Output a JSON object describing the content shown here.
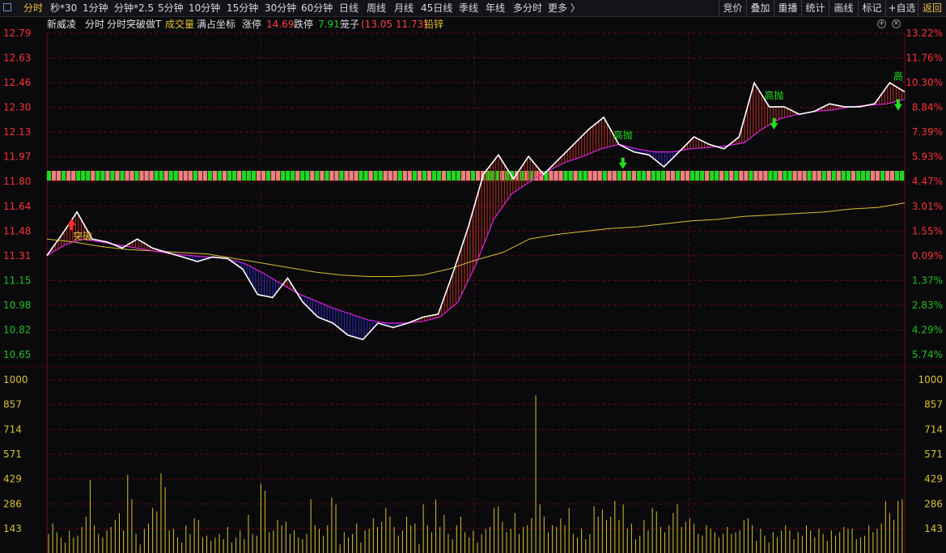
{
  "toolbar": {
    "periods": [
      {
        "label": "分时",
        "active": true
      },
      {
        "label": "秒*30"
      },
      {
        "label": "1分钟"
      },
      {
        "label": "分钟*2.5"
      },
      {
        "label": "5分钟"
      },
      {
        "label": "10分钟"
      },
      {
        "label": "15分钟"
      },
      {
        "label": "30分钟"
      },
      {
        "label": "60分钟"
      },
      {
        "label": "日线"
      },
      {
        "label": "周线"
      },
      {
        "label": "月线"
      },
      {
        "label": "45日线"
      },
      {
        "label": "季线"
      },
      {
        "label": "年线"
      },
      {
        "label": "多分时"
      },
      {
        "label": "更多 〉"
      }
    ],
    "right_buttons": [
      "竞价",
      "叠加",
      "重播",
      "统计",
      "画线",
      "标记",
      "+自选",
      "返回"
    ],
    "back_color": "#f0c040"
  },
  "info": {
    "stock_name": "新威凌",
    "chart_type": "分时",
    "indicator": "分时突破做T",
    "volume_label": "成交量",
    "coord_mode": "满占坐标",
    "limit_up_label": "涨停",
    "limit_up_value": "14.69",
    "limit_down_label": "跌停",
    "limit_down_value": "7.91",
    "cage_label": "笼子",
    "cage_value": "(13.05 11.73)",
    "sector": "铅锌"
  },
  "chart_data": {
    "type": "line",
    "price_axis": {
      "ticks": [
        "12.79",
        "12.63",
        "12.46",
        "12.30",
        "12.13",
        "11.97",
        "11.80",
        "11.64",
        "11.48",
        "11.31",
        "11.15",
        "10.98",
        "10.82",
        "10.65"
      ],
      "ylim": [
        10.65,
        12.79
      ]
    },
    "percent_axis": {
      "ticks": [
        "13.22%",
        "11.76%",
        "10.30%",
        "8.84%",
        "7.39%",
        "5.93%",
        "4.47%",
        "3.01%",
        "1.55%",
        "0.09%",
        "1.37%",
        "2.83%",
        "4.29%",
        "5.74%"
      ]
    },
    "volume_axis": {
      "ticks": [
        "1000",
        "857",
        "714",
        "571",
        "429",
        "286",
        "143"
      ],
      "ylim": [
        0,
        1000
      ]
    },
    "x": [
      0,
      15,
      30,
      45,
      60,
      75,
      90,
      105,
      120,
      135,
      150,
      165,
      180,
      195,
      210,
      225,
      240,
      255,
      270,
      285,
      300,
      315,
      330,
      345,
      360,
      375,
      390,
      405,
      420,
      435,
      450,
      465,
      480,
      495,
      510,
      525,
      540,
      555,
      570,
      585,
      600,
      615,
      630,
      645,
      660,
      675,
      690,
      705,
      720,
      735,
      750,
      765,
      780,
      795,
      810,
      825,
      840,
      855,
      870,
      885,
      900,
      915,
      930,
      945,
      960,
      975,
      990,
      1005,
      1020,
      1035,
      1050
    ],
    "series": [
      {
        "values": [
          11.31,
          11.45,
          11.6,
          11.42,
          11.4,
          11.36,
          11.42,
          11.36,
          11.33,
          11.3,
          11.27,
          11.3,
          11.29,
          11.22,
          11.05,
          11.03,
          11.16,
          11.0,
          10.9,
          10.86,
          10.78,
          10.75,
          10.86,
          10.83,
          10.86,
          10.9,
          10.92,
          11.2,
          11.5,
          11.85,
          11.98,
          11.82,
          11.97,
          11.85,
          11.95,
          12.05,
          12.15,
          12.23,
          12.05,
          12.0,
          11.98,
          11.9,
          12.0,
          12.1,
          12.05,
          12.02,
          12.1,
          12.46,
          12.3,
          12.3,
          12.25,
          12.27,
          12.32,
          12.3,
          12.3,
          12.32,
          12.46,
          12.4
        ]
      },
      {
        "values": [
          11.31,
          11.38,
          11.42,
          11.4,
          11.38,
          11.36,
          11.34,
          11.32,
          11.31,
          11.3,
          11.29,
          11.26,
          11.2,
          11.13,
          11.06,
          11.01,
          10.96,
          10.92,
          10.88,
          10.86,
          10.86,
          10.87,
          10.9,
          11.0,
          11.25,
          11.55,
          11.72,
          11.8,
          11.87,
          11.93,
          11.97,
          12.02,
          12.05,
          12.02,
          12.0,
          12.0,
          12.02,
          12.03,
          12.04,
          12.06,
          12.15,
          12.22,
          12.25,
          12.27,
          12.28,
          12.3,
          12.31,
          12.32,
          12.35
        ]
      },
      {
        "values": [
          11.42,
          11.4,
          11.37,
          11.35,
          11.34,
          11.33,
          11.32,
          11.29,
          11.26,
          11.23,
          11.2,
          11.18,
          11.17,
          11.17,
          11.18,
          11.22,
          11.28,
          11.33,
          11.42,
          11.45,
          11.47,
          11.49,
          11.5,
          11.52,
          11.54,
          11.55,
          11.57,
          11.58,
          11.59,
          11.6,
          11.62,
          11.63,
          11.66
        ]
      }
    ],
    "volume": [
      110,
      170,
      120,
      90,
      60,
      130,
      90,
      100,
      150,
      210,
      420,
      160,
      110,
      90,
      130,
      150,
      190,
      230,
      130,
      450,
      310,
      110,
      50,
      140,
      170,
      260,
      240,
      460,
      380,
      130,
      140,
      90,
      60,
      160,
      110,
      200,
      190,
      90,
      100,
      70,
      90,
      110,
      80,
      150,
      60,
      90,
      130,
      80,
      220,
      110,
      100,
      400,
      360,
      120,
      130,
      190,
      160,
      180,
      110,
      130,
      90,
      80,
      110,
      310,
      160,
      140,
      100,
      160,
      320,
      280,
      50,
      120,
      90,
      110,
      170,
      60,
      130,
      140,
      200,
      150,
      180,
      260,
      210,
      150,
      100,
      130,
      210,
      160,
      170,
      50,
      280,
      160,
      120,
      310,
      150,
      220,
      110,
      80,
      160,
      210,
      120,
      90,
      130,
      60,
      110,
      140,
      150,
      260,
      270,
      180,
      120,
      140,
      230,
      110,
      150,
      160,
      200,
      910,
      280,
      210,
      120,
      160,
      150,
      200,
      160,
      260,
      110,
      90,
      140,
      80,
      110,
      270,
      210,
      250,
      190,
      210,
      300,
      190,
      280,
      140,
      170,
      80,
      100,
      190,
      130,
      260,
      240,
      150,
      120,
      160,
      230,
      280,
      150,
      180,
      200,
      170,
      110,
      100,
      160,
      140,
      120,
      90,
      110,
      150,
      110,
      120,
      130,
      190,
      200,
      160,
      70,
      140,
      100,
      60,
      120,
      90,
      130,
      160,
      130,
      80,
      120,
      100,
      160,
      130,
      90,
      140,
      110,
      70,
      130,
      100,
      120,
      150,
      140,
      140,
      80,
      90,
      100,
      160,
      120,
      140,
      170,
      300,
      230,
      190,
      300,
      310
    ],
    "markers": [
      {
        "label": "突破",
        "color": "#f0c040",
        "arrow": "up",
        "arrow_color": "#ff3030",
        "x": 30
      },
      {
        "label": "高抛",
        "color": "#20e020",
        "arrow": "down",
        "arrow_color": "#20e020",
        "x": 705
      },
      {
        "label": "高抛",
        "color": "#20e020",
        "arrow": "down",
        "arrow_color": "#20e020",
        "x": 890
      },
      {
        "label": "高",
        "color": "#20e020",
        "arrow": "down",
        "arrow_color": "#20e020",
        "x": 1042
      }
    ],
    "status_bar": [
      "#f08080",
      "#20d820"
    ],
    "colors": {
      "price_line": "#ffffff",
      "avg_line": "#e020e0",
      "slow_line": "#d8c030",
      "fill_above": "#c03020",
      "fill_below": "#2a2ad0",
      "volume_bar": "#d8c030",
      "grid": "#5a0a0a",
      "up": "#ff3030",
      "down": "#20c020"
    }
  }
}
